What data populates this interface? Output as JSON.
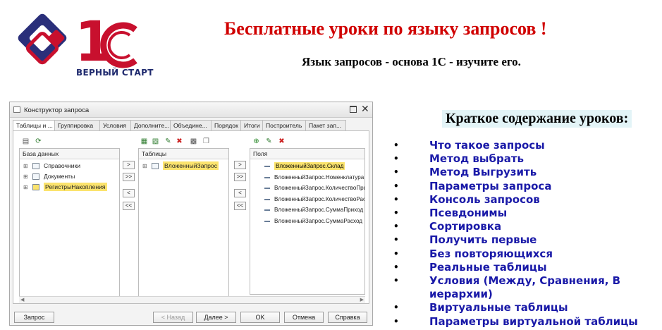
{
  "logo": {
    "text": "ВЕРНЫЙ СТАРТ"
  },
  "header": {
    "title": "Бесплатные уроки по языку запросов !",
    "subtitle": "Язык запросов - основа 1С - изучите его."
  },
  "colors": {
    "title": "#d00000",
    "links": "#1a1aa8",
    "logo_blue": "#1f2a6e",
    "logo_red": "#c8102e",
    "highlight": "#fbe36d"
  },
  "toc": {
    "title": "Краткое содержание уроков:",
    "items": [
      "Что такое запросы",
      "Метод выбрать",
      "Метод Выгрузить",
      "Параметры запроса",
      "Консоль запросов",
      "Псевдонимы",
      "Сортировка",
      "Получить первые",
      "Без повторяющихся",
      "Реальные таблицы",
      "Условия (Между, Сравнения, В иерархии)",
      "Виртуальные таблицы",
      "Параметры виртуальной таблицы"
    ]
  },
  "window": {
    "title": "Конструктор запроса",
    "tabs": [
      "Таблицы и ...",
      "Группировка",
      "Условия",
      "Дополните...",
      "Объедине...",
      "Порядок",
      "Итоги",
      "Построитель",
      "Пакет зап..."
    ],
    "database": {
      "header": "База данных",
      "items": [
        "Справочники",
        "Документы",
        "РегистрыНакопления"
      ]
    },
    "tables": {
      "header": "Таблицы",
      "items": [
        "ВложенныйЗапрос"
      ]
    },
    "fields": {
      "header": "Поля",
      "items": [
        "ВложенныйЗапрос.Склад",
        "ВложенныйЗапрос.Номенклатура",
        "ВложенныйЗапрос.КоличествоПриход",
        "ВложенныйЗапрос.КоличествоРасход",
        "ВложенныйЗапрос.СуммаПриход",
        "ВложенныйЗапрос.СуммаРасход"
      ]
    },
    "move_buttons": [
      ">",
      ">>",
      "<",
      "<<"
    ],
    "buttons": {
      "query": "Запрос",
      "back": "< Назад",
      "next": "Далее >",
      "ok": "OK",
      "cancel": "Отмена",
      "help": "Справка"
    },
    "icons": [
      "window-icon",
      "maximize-icon",
      "close-icon",
      "add-icon",
      "edit-icon",
      "delete-icon",
      "refresh-icon"
    ]
  }
}
